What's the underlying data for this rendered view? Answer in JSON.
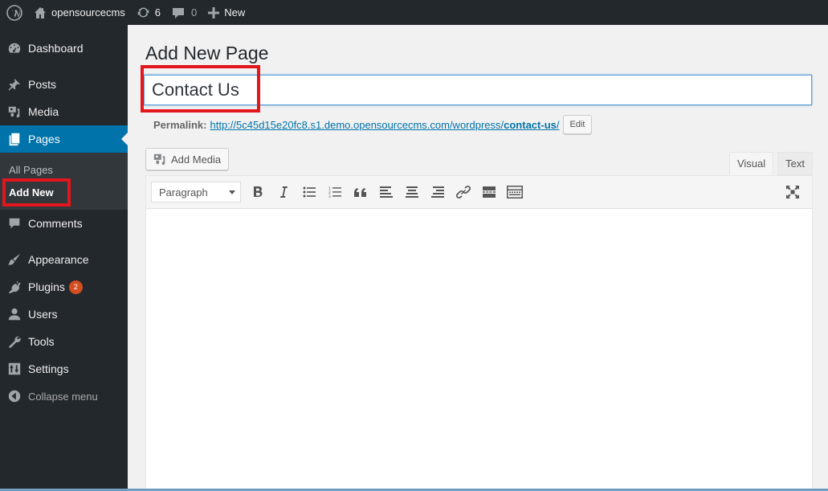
{
  "adminbar": {
    "wp_icon": "wordpress-logo-icon",
    "site_icon": "home-icon",
    "site_name": "opensourcecms",
    "updates_icon": "updates-icon",
    "updates_count": "6",
    "comments_icon": "comment-bubble-icon",
    "comments_count": "0",
    "new_icon": "plus-icon",
    "new_label": "New"
  },
  "sidebar": {
    "items": [
      {
        "label": "Dashboard",
        "icon": "dashboard-icon"
      },
      {
        "label": "Posts",
        "icon": "pushpin-icon"
      },
      {
        "label": "Media",
        "icon": "media-icon"
      },
      {
        "label": "Pages",
        "icon": "pages-icon",
        "current": true
      },
      {
        "label": "Comments",
        "icon": "comment-icon"
      },
      {
        "label": "Appearance",
        "icon": "paintbrush-icon"
      },
      {
        "label": "Plugins",
        "icon": "plugin-icon",
        "badge": "2"
      },
      {
        "label": "Users",
        "icon": "user-icon"
      },
      {
        "label": "Tools",
        "icon": "wrench-icon"
      },
      {
        "label": "Settings",
        "icon": "settings-icon"
      }
    ],
    "submenu": [
      {
        "label": "All Pages"
      },
      {
        "label": "Add New",
        "current": true
      }
    ],
    "collapse_label": "Collapse menu"
  },
  "main": {
    "page_title": "Add New Page",
    "title_value": "Contact Us",
    "permalink_label": "Permalink:",
    "permalink_base": "http://5c45d15e20fc8.s1.demo.opensourcecms.com/wordpress/",
    "permalink_slug": "contact-us",
    "permalink_trail": "/",
    "edit_label": "Edit",
    "add_media_label": "Add Media",
    "tabs": [
      {
        "label": "Visual",
        "active": true
      },
      {
        "label": "Text",
        "active": false
      }
    ],
    "toolbar": {
      "format_value": "Paragraph",
      "buttons": [
        "bold",
        "italic",
        "bulleted-list",
        "numbered-list",
        "blockquote",
        "align-left",
        "align-center",
        "align-right",
        "insert-link",
        "read-more",
        "toolbar-toggle"
      ],
      "fullscreen": "fullscreen"
    }
  },
  "colors": {
    "admin_dark": "#23282d",
    "accent": "#0073aa",
    "highlight_red": "#e3151d",
    "badge": "#d54e21"
  }
}
